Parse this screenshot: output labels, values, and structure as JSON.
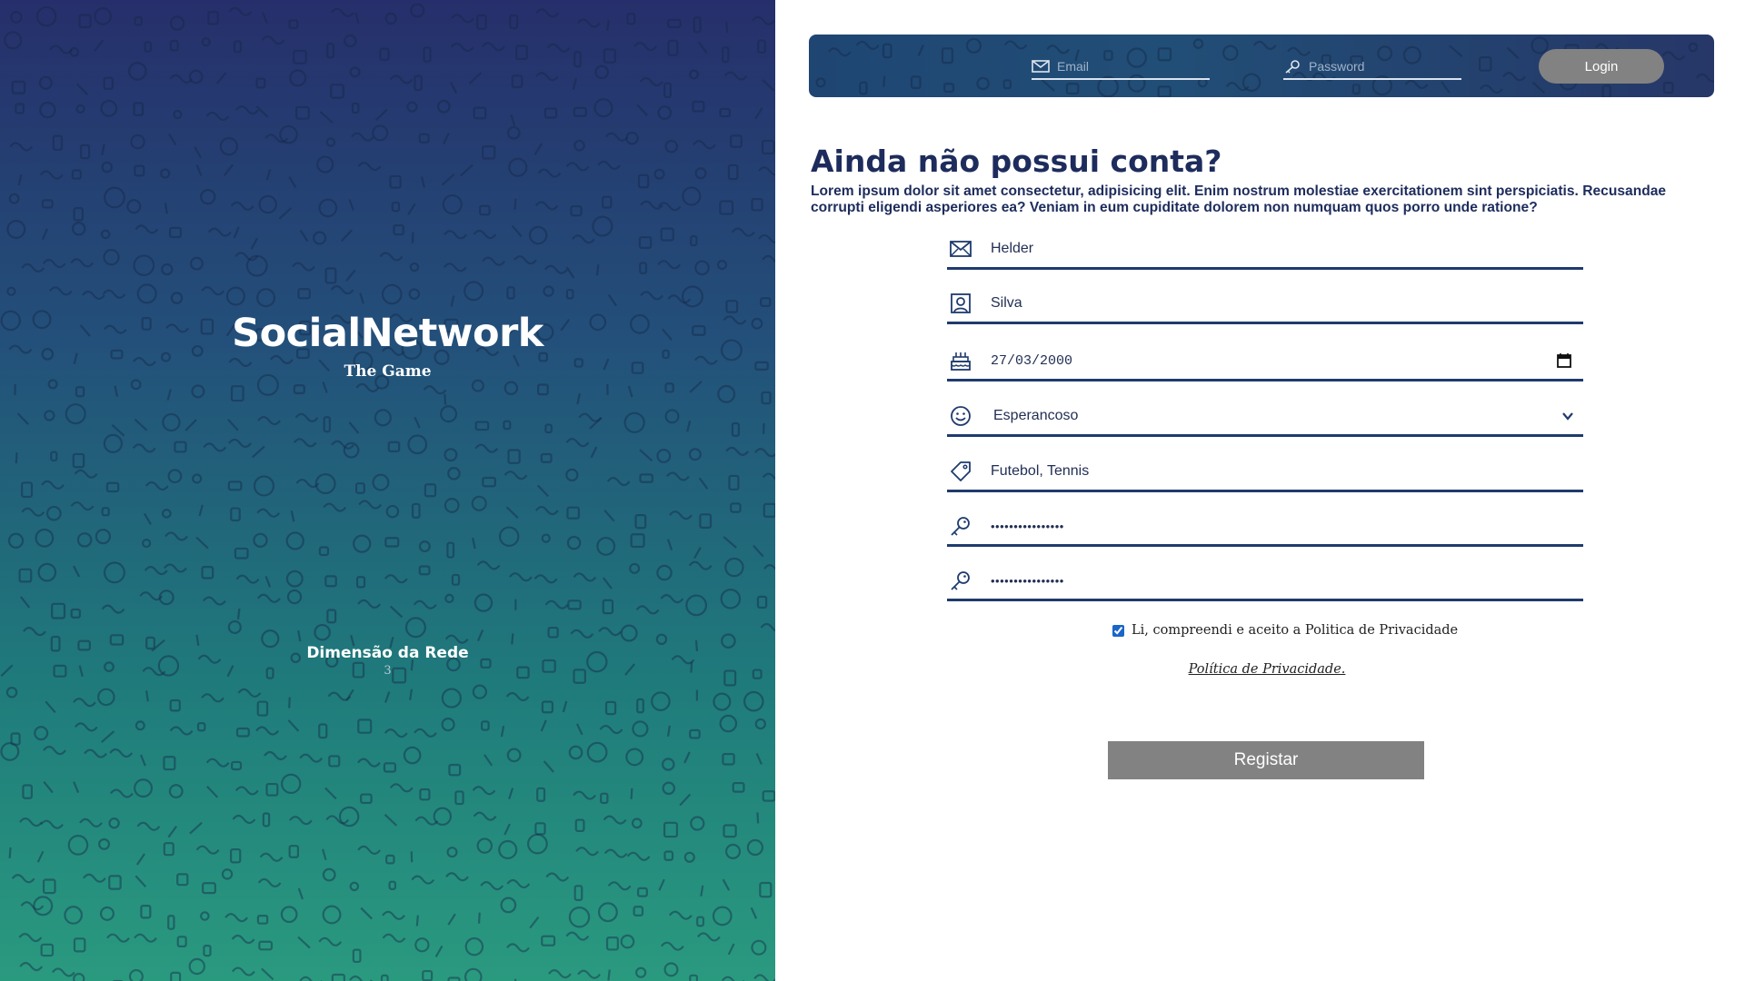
{
  "hero": {
    "title": "SocialNetwork",
    "subtitle": "The Game",
    "dimension_label": "Dimensão da Rede",
    "dimension_value": "3"
  },
  "login": {
    "email_placeholder": "Email",
    "password_placeholder": "Password",
    "button_label": "Login"
  },
  "register": {
    "title": "Ainda não possui conta?",
    "description": "Lorem ipsum dolor sit amet consectetur, adipisicing elit. Enim nostrum molestiae exercitationem sint perspiciatis. Recusandae corrupti eligendi asperiores ea? Veniam in eum cupiditate dolorem non numquam quos porro unde ratione?",
    "fields": {
      "first_name": "Helder",
      "last_name": "Silva",
      "birth_date": "27/03/2000",
      "mood": "Esperancoso",
      "tags": "Futebol, Tennis",
      "password": "••••••••••••••••",
      "password_confirm": "••••••••••••••••"
    },
    "consent_label": "Li, compreendi e aceito a Politica de Privacidade",
    "privacy_link": "Política de Privacidade.",
    "submit_label": "Registar"
  },
  "colors": {
    "heading": "#1d2c5c",
    "underline": "#1f3b6d",
    "button": "#828282",
    "hero_top": "#262f6b",
    "hero_bottom": "#2a9a7f"
  }
}
